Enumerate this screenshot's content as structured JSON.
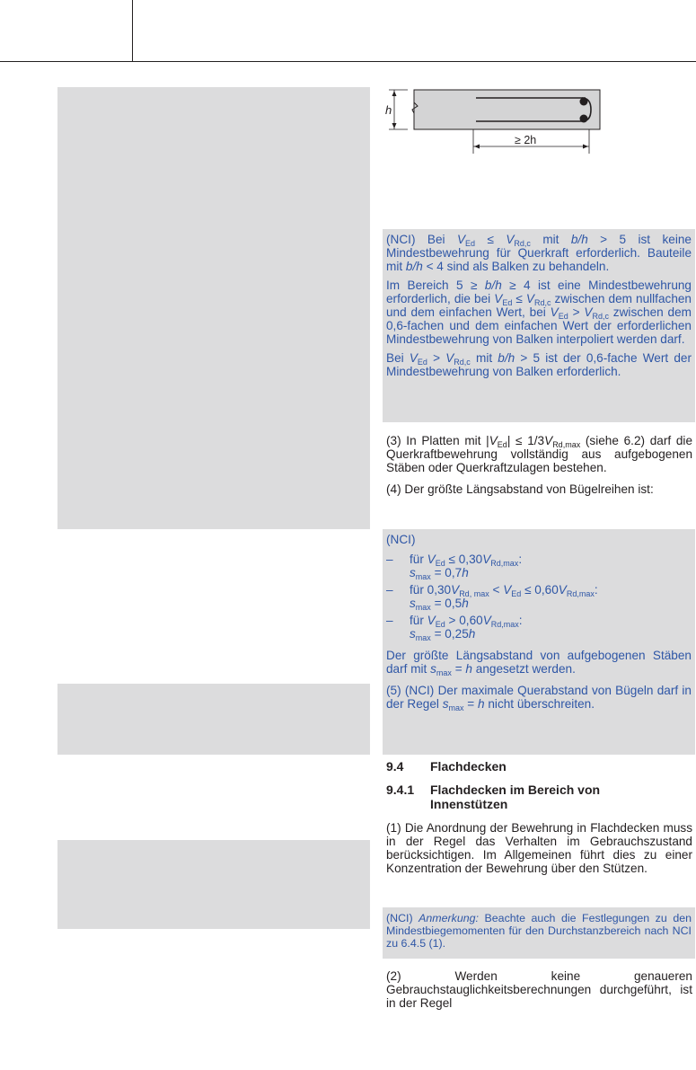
{
  "figure": {
    "h_label": "h",
    "dim_label": "≥ 2h"
  },
  "nci_block1": {
    "p1": {
      "a": "(NCI) Bei ",
      "v": "V",
      "s1": "Ed",
      "b": " ≤ ",
      "v2": "V",
      "s2": "Rd,c",
      "c": " mit ",
      "bh": "b/h",
      "d": " > 5 ist keine Mindestbewehrung für Querkraft erforderlich. Bauteile mit ",
      "bh2": "b/h",
      "e": " < 4 sind als Balken zu behandeln."
    },
    "p2": {
      "a": "Im Bereich 5 ≥ ",
      "bh": "b/h",
      "b": " ≥ 4 ist eine Mindestbewehrung erforderlich, die bei ",
      "v": "V",
      "s1": "Ed",
      "c": " ≤ ",
      "v2": "V",
      "s2": "Rd,c",
      "d": " zwischen dem nullfachen und dem einfachen Wert, bei ",
      "v3": "V",
      "s3": "Ed",
      "e": " > ",
      "v4": "V",
      "s4": "Rd,c",
      "f": " zwischen dem 0,6-fachen und dem einfachen Wert der erforderlichen Mindestbewehrung von Balken interpoliert werden darf."
    },
    "p3": {
      "a": "Bei ",
      "v": "V",
      "s1": "Ed",
      "b": " > ",
      "v2": "V",
      "s2": "Rd,c",
      "c": " mit ",
      "bh": "b/h",
      "d": " > 5 ist der 0,6-fache Wert der Mindestbewehrung von Balken erforderlich."
    }
  },
  "para3": {
    "a": "(3) In Platten mit |",
    "v": "V",
    "s1": "Ed",
    "b": "| ≤ 1/3",
    "v2": "V",
    "s2": "Rd,max",
    "c": " (siehe 6.2) darf die Querkraftbewehrung vollständig aus aufgebogenen Stäben oder Querkraftzulagen bestehen."
  },
  "para4": "(4) Der größte Längsabstand von Bügelreihen ist:",
  "nci_block2": {
    "label": "(NCI)",
    "dash": "–",
    "items": [
      {
        "a": "für ",
        "v": "V",
        "s1": "Ed",
        "b": " ≤ 0,30",
        "v2": "V",
        "s2": "Rd,max",
        "c": ":",
        "sv": "s",
        "ss": "max",
        "d": " = 0,7",
        "h": "h"
      },
      {
        "a": "für 0,30",
        "v": "V",
        "s1": "Rd, max",
        "b": " < ",
        "v2": "V",
        "s2": "Ed",
        "b2": " ≤ 0,60",
        "v3": "V",
        "s3": "Rd,max",
        "c": ":",
        "sv": "s",
        "ss": "max",
        "d": " = 0,5",
        "h": "h"
      },
      {
        "a": "für ",
        "v": "V",
        "s1": "Ed",
        "b": " > 0,60",
        "v2": "V",
        "s2": "Rd,max",
        "c": ":",
        "sv": "s",
        "ss": "max",
        "d": " = 0,25",
        "h": "h"
      }
    ],
    "p_after": {
      "a": "Der größte Längsabstand von aufgebogenen Stäben darf mit ",
      "sv": "s",
      "ss": "max",
      "b": " = ",
      "h": "h",
      "c": " angesetzt werden."
    },
    "p5": {
      "a": "(5) (NCI) Der maximale Querabstand von Bügeln darf in der Regel ",
      "sv": "s",
      "ss": "max",
      "b": " = ",
      "h": "h",
      "c": " nicht überschreiten."
    }
  },
  "section": {
    "num": "9.4",
    "title": "Flachdecken"
  },
  "subsection": {
    "num": "9.4.1",
    "title": "Flachdecken im Bereich von Innenstützen"
  },
  "para1": "(1) Die Anordnung der Bewehrung in Flachdecken muss in der Regel das Verhalten im Gebrauchszustand berücksichtigen. Im Allgemeinen führt dies zu einer Konzentration der Bewehrung über den Stützen.",
  "nci_note": {
    "a": "(NCI) ",
    "label": "Anmerkung:",
    "b": " Beachte auch die Festlegungen zu den Mindestbiegemomenten für den Durchstanzbereich nach NCI zu 6.4.5 (1)."
  },
  "para2": "(2) Werden keine genaueren Gebrauchstauglichkeitsberechnungen durchgeführt, ist in der Regel"
}
